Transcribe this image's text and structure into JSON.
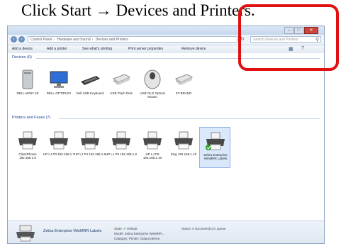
{
  "caption": "Click Start → Devices and Printers.",
  "window": {
    "address": {
      "segments": [
        "Control Panel",
        "Hardware and Sound",
        "Devices and Printers"
      ],
      "search_placeholder": "Search Devices and Printers"
    },
    "toolbar": [
      "Add a device",
      "Add a printer",
      "See what's printing",
      "Print server properties",
      "Remove device"
    ],
    "groups": {
      "devices": {
        "heading": "Devices (6)",
        "items": [
          {
            "label": "DELL-WIN7-1E",
            "icon": "pc-tower-icon"
          },
          {
            "label": "DELL-OPTIPLEX",
            "icon": "monitor-icon"
          },
          {
            "label": "Dell USB Keyboard",
            "icon": "keyboard-icon"
          },
          {
            "label": "USB Flash Disk",
            "icon": "drive-icon"
          },
          {
            "label": "USB OLG Optical Mouse",
            "icon": "mouse-icon"
          },
          {
            "label": "ST-BRAND",
            "icon": "drive-icon"
          }
        ]
      },
      "printers": {
        "heading": "Printers and Faxes (7)",
        "items": [
          {
            "label": "ClassPhotos 192.168.1.5",
            "icon": "printer-icon"
          },
          {
            "label": "HP LJ P3 192.168.1.7",
            "icon": "printer-icon"
          },
          {
            "label": "HP LJ P4 192.168.1.8",
            "icon": "printer-icon"
          },
          {
            "label": "HP LJ P5 192.168.1.9",
            "icon": "printer-icon"
          },
          {
            "label": "HP LJ P6 192.168.1.10",
            "icon": "printer-icon"
          },
          {
            "label": "Zing 192.168.1.19",
            "icon": "printer-icon"
          },
          {
            "label": "Zebra Enterprise WinMRR Labels",
            "icon": "printer-default-icon",
            "selected": true
          }
        ]
      }
    },
    "details": {
      "name": "Zebra Enterprise WinMRR Labels",
      "state_label": "State:",
      "state_value": "Default",
      "model_label": "Model:",
      "model_value": "Zebra Enterprise WinMRR...",
      "category_label": "Category:",
      "category_value": "Printer; Output device",
      "status_label": "Status:",
      "status_value": "0 document(s) in queue"
    }
  },
  "annotation": {
    "color": "#e01010",
    "target": "search-box"
  }
}
